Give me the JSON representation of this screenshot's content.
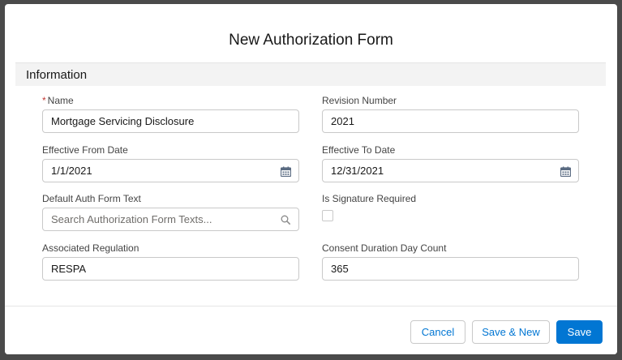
{
  "modal": {
    "title": "New Authorization Form"
  },
  "section": {
    "title": "Information"
  },
  "fields": {
    "name": {
      "label": "Name",
      "required_mark": "*",
      "value": "Mortgage Servicing Disclosure"
    },
    "revision_number": {
      "label": "Revision Number",
      "value": "2021"
    },
    "effective_from": {
      "label": "Effective From Date",
      "value": "1/1/2021",
      "icon": "calendar-icon"
    },
    "effective_to": {
      "label": "Effective To Date",
      "value": "12/31/2021",
      "icon": "calendar-icon"
    },
    "default_auth_form_text": {
      "label": "Default Auth Form Text",
      "placeholder": "Search Authorization Form Texts...",
      "value": "",
      "icon": "search-icon"
    },
    "is_signature_required": {
      "label": "Is Signature Required",
      "checked": false
    },
    "associated_regulation": {
      "label": "Associated Regulation",
      "value": "RESPA"
    },
    "consent_duration": {
      "label": "Consent Duration Day Count",
      "value": "365"
    }
  },
  "footer": {
    "cancel_label": "Cancel",
    "save_new_label": "Save & New",
    "save_label": "Save"
  },
  "colors": {
    "brand": "#0176d3",
    "required": "#c23934",
    "icon": "#747474",
    "backdrop": "#4a4a4a"
  }
}
